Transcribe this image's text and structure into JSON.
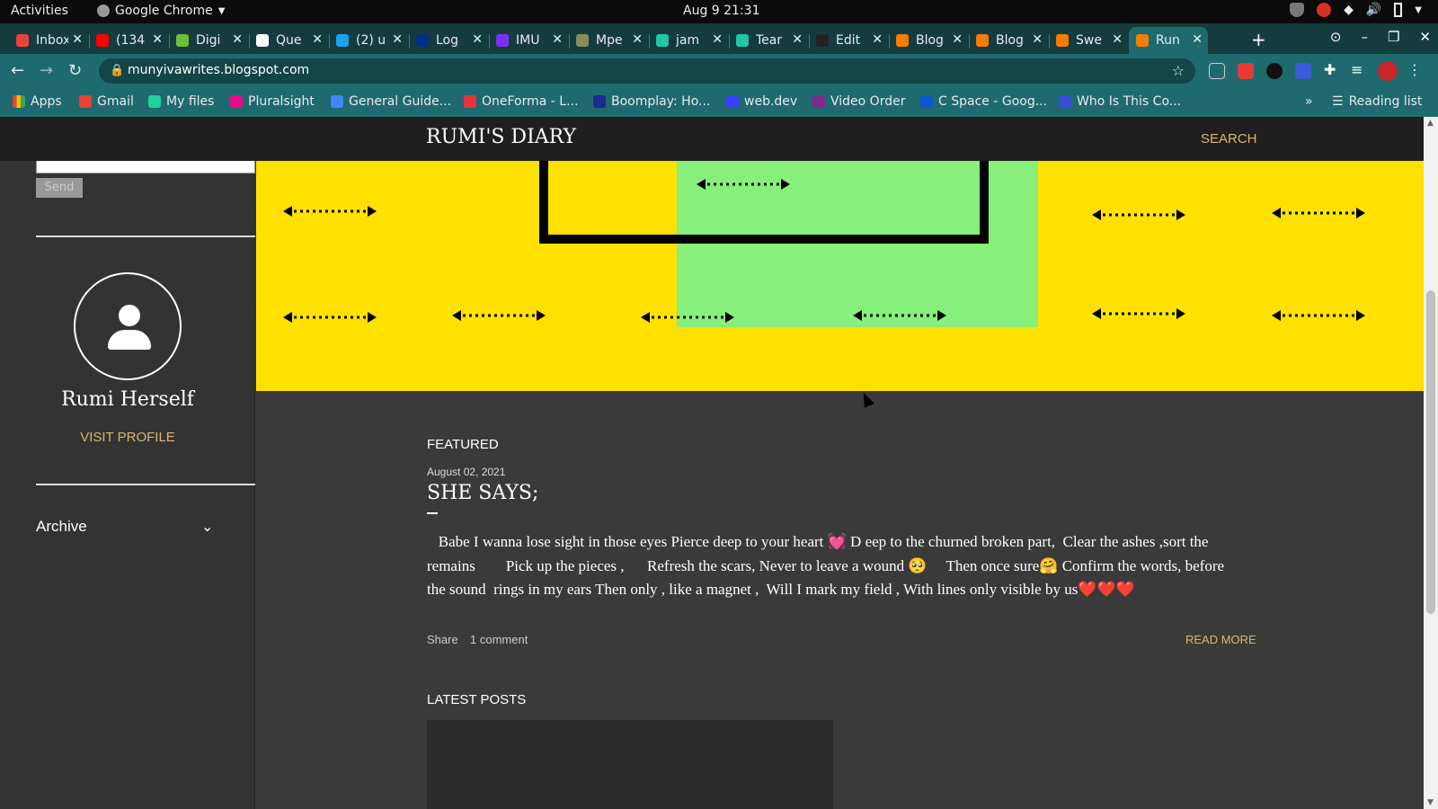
{
  "system": {
    "activities": "Activities",
    "app_name": "Google Chrome",
    "clock": "Aug 9  21:31"
  },
  "tabs": [
    {
      "label": "Inbox",
      "icon": "gmail-icon",
      "color": "#ea4335"
    },
    {
      "label": "(134",
      "icon": "youtube-icon",
      "color": "#ff0000"
    },
    {
      "label": "Digi",
      "icon": "digi-icon",
      "color": "#6bbf3b"
    },
    {
      "label": "Que",
      "icon": "pdf-icon",
      "color": "#ffffff"
    },
    {
      "label": "(2) u",
      "icon": "twitter-icon",
      "color": "#1da1f2"
    },
    {
      "label": "Log",
      "icon": "paypal-icon",
      "color": "#003087"
    },
    {
      "label": "IMU",
      "icon": "list-icon",
      "color": "#7b2ff7"
    },
    {
      "label": "Mpe",
      "icon": "globe-icon",
      "color": "#8b8b5a"
    },
    {
      "label": "jam",
      "icon": "diamond-icon",
      "color": "#1fc7a6"
    },
    {
      "label": "Tear",
      "icon": "diamond-icon",
      "color": "#1fc7a6"
    },
    {
      "label": "Edit",
      "icon": "github-icon",
      "color": "#222222"
    },
    {
      "label": "Blog",
      "icon": "blogger-icon",
      "color": "#f57d00"
    },
    {
      "label": "Blog",
      "icon": "blogger-icon",
      "color": "#f57d00"
    },
    {
      "label": "Swe",
      "icon": "blogger-icon",
      "color": "#f57d00"
    },
    {
      "label": "Run",
      "icon": "blogger-icon",
      "color": "#f57d00",
      "active": true
    }
  ],
  "toolbar": {
    "url": "munyivawrites.blogspot.com"
  },
  "bookmarks": {
    "apps": "Apps",
    "items": [
      {
        "label": "Gmail",
        "color": "#ea4335"
      },
      {
        "label": "My files",
        "color": "#1fd0a0"
      },
      {
        "label": "Pluralsight",
        "color": "#e80a89"
      },
      {
        "label": "General Guide...",
        "color": "#4285f4"
      },
      {
        "label": "OneForma - L...",
        "color": "#e5343a"
      },
      {
        "label": "Boomplay: Ho...",
        "color": "#1d2a8f"
      },
      {
        "label": "web.dev",
        "color": "#3740ff"
      },
      {
        "label": "Video Order",
        "color": "#7b2d8b"
      },
      {
        "label": "C Space - Goog...",
        "color": "#0b57d0"
      },
      {
        "label": "Who Is This Co...",
        "color": "#3c4cd8"
      }
    ],
    "more": "»",
    "reading_list": "Reading list"
  },
  "blog": {
    "title": "RUMI'S DIARY",
    "search": "SEARCH",
    "send_label": "Send",
    "profile_name": "Rumi Herself",
    "visit_profile": "VISIT PROFILE",
    "archive": "Archive",
    "featured_label": "FEATURED",
    "post_date": "August 02, 2021",
    "post_title": "SHE SAYS;",
    "post_excerpt": "   Babe I wanna lose sight in those eyes Pierce deep to your heart 💓 D eep to the churned broken part,  Clear the ashes ,sort the remains        Pick up the pieces ,      Refresh the scars, Never to leave a wound 🥺     Then once sure🤗 Confirm the words, before the sound  rings in my ears Then only , like a magnet ,  Will I mark my field , With lines only visible by us❤️❤️❤️",
    "share": "Share",
    "comments": "1 comment",
    "read_more": "READ MORE",
    "latest_posts": "LATEST POSTS"
  },
  "colors": {
    "header_yellow": "#ffe100",
    "header_green": "#86f07a",
    "chrome_theme": "#1e6a6f",
    "link_gold": "#d9b66a"
  }
}
